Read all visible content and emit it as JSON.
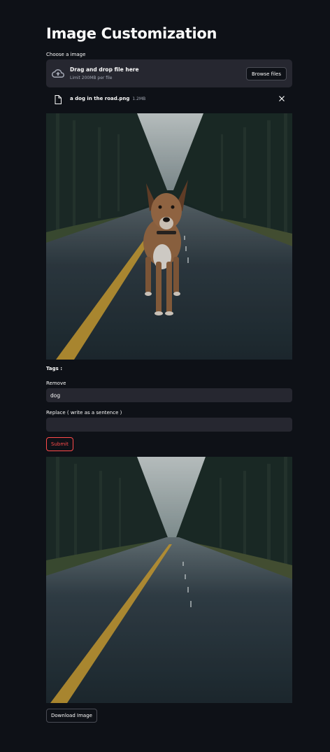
{
  "page": {
    "title": "Image Customization"
  },
  "uploader": {
    "label": "Choose a image",
    "drop_title": "Drag and drop file here",
    "drop_subtitle": "Limit 200MB per file",
    "browse_label": "Browse files",
    "file": {
      "name": "a dog in the road.png",
      "size": "1.2MB"
    }
  },
  "tags_label": "Tags :",
  "remove": {
    "label": "Remove",
    "value": "dog"
  },
  "replace": {
    "label": "Replace ( write as a sentence )",
    "value": ""
  },
  "submit_label": "Submit",
  "download_label": "Download Image",
  "colors": {
    "background": "#0e1117",
    "surface": "#262730",
    "accent": "#ff4b4b",
    "text": "#fafafa"
  },
  "icons": {
    "upload": "cloud-upload-icon",
    "file": "file-icon",
    "close": "close-icon"
  }
}
